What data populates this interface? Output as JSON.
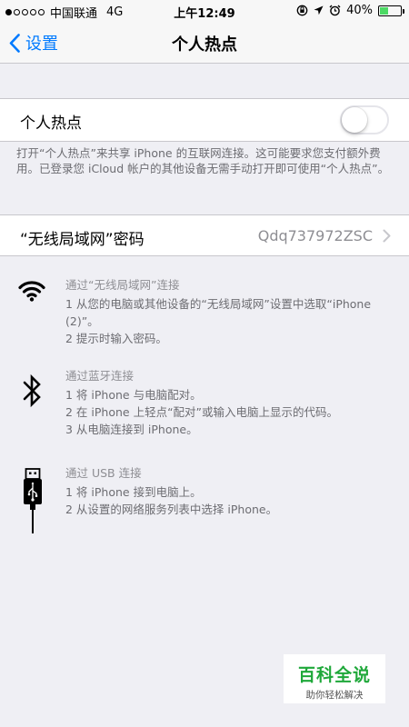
{
  "status_bar": {
    "carrier": "中国联通",
    "network": "4G",
    "time": "上午12:49",
    "battery_percent": "40%",
    "battery_level": 0.4
  },
  "nav": {
    "back_label": "设置",
    "title": "个人热点"
  },
  "hotspot": {
    "label": "个人热点",
    "enabled": false,
    "note": "打开“个人热点”来共享 iPhone 的互联网连接。这可能要求您支付额外费用。已登录您 iCloud 帐户的其他设备无需手动打开即可使用“个人热点”。"
  },
  "wifi_password": {
    "label": "“无线局域网”密码",
    "value": "Qdq737972ZSC"
  },
  "instructions": {
    "wifi": {
      "heading": "通过“无线局域网”连接",
      "step1": "1 从您的电脑或其他设备的“无线局域网”设置中选取“iPhone (2)”。",
      "step2": "2 提示时输入密码。"
    },
    "bluetooth": {
      "heading": "通过蓝牙连接",
      "step1": "1 将 iPhone 与电脑配对。",
      "step2": "2 在 iPhone 上轻点“配对”或输入电脑上显示的代码。",
      "step3": "3 从电脑连接到 iPhone。"
    },
    "usb": {
      "heading": "通过 USB 连接",
      "step1": "1 将 iPhone 接到电脑上。",
      "step2": "2 从设置的网络服务列表中选择 iPhone。"
    }
  },
  "watermark": {
    "title": "百科全说",
    "subtitle": "助你轻松解决"
  },
  "colors": {
    "accent": "#007aff",
    "background": "#efeff4",
    "battery": "#4cd964",
    "watermark_green": "#1fa83a"
  }
}
